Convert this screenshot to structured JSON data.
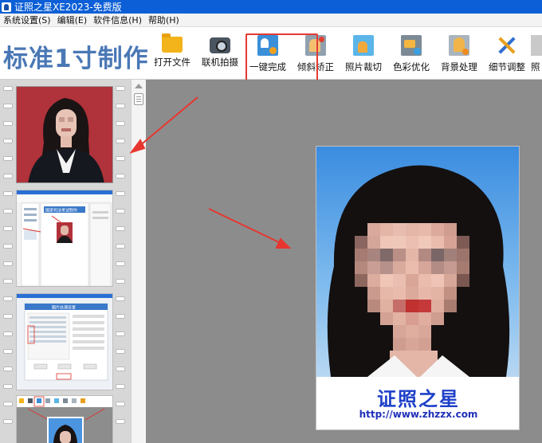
{
  "window": {
    "title": "证照之星XE2023-免费版"
  },
  "menu": [
    "系统设置(S)",
    "编辑(E)",
    "软件信息(H)",
    "帮助(H)"
  ],
  "toolbar": {
    "heading": "标准1寸制作",
    "tools": [
      {
        "label": "打开文件",
        "icon": "folder-icon"
      },
      {
        "label": "联机拍摄",
        "icon": "camera-icon"
      },
      {
        "label": "一键完成",
        "icon": "one-click-icon"
      },
      {
        "label": "倾斜矫正",
        "icon": "tilt-correct-icon"
      },
      {
        "label": "照片裁切",
        "icon": "crop-icon"
      },
      {
        "label": "色彩优化",
        "icon": "color-optimize-icon"
      },
      {
        "label": "背景处理",
        "icon": "background-icon"
      },
      {
        "label": "细节调整",
        "icon": "detail-adjust-icon"
      },
      {
        "label": "照"
      }
    ]
  },
  "thumbnails": {
    "second": {
      "dialog_title": "国家司法考试制作"
    },
    "third": {
      "dialog_title": "图片处理设置"
    }
  },
  "preview": {
    "brand": "证照之星",
    "url": "http://www.zhzzx.com"
  },
  "colors": {
    "title_bar": "#0c5fd6",
    "heading": "#4a78b5",
    "highlight": "#e43a33",
    "photo_background": "#4a94e0",
    "portrait_background": "#b0323a",
    "brand": "#1e40c8"
  }
}
